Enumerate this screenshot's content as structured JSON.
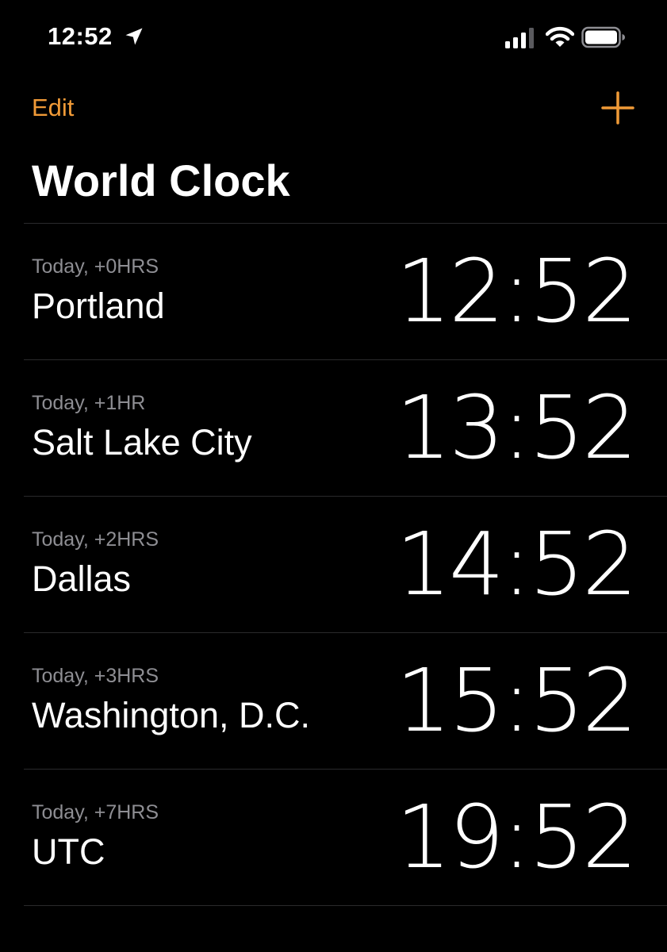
{
  "status_bar": {
    "time": "12:52",
    "icons": [
      "location-arrow-icon",
      "cellular-signal-icon",
      "wifi-icon",
      "battery-icon"
    ]
  },
  "nav": {
    "edit_label": "Edit",
    "add_icon": "plus-icon"
  },
  "title": "World Clock",
  "colors": {
    "accent": "#f09a37",
    "background": "#000000",
    "text_primary": "#ffffff",
    "text_secondary": "#8e8e93",
    "separator": "#2a2a2c"
  },
  "clocks": [
    {
      "offset": "Today, +0HRS",
      "city": "Portland",
      "time": "12:52"
    },
    {
      "offset": "Today, +1HR",
      "city": "Salt Lake City",
      "time": "13:52"
    },
    {
      "offset": "Today, +2HRS",
      "city": "Dallas",
      "time": "14:52"
    },
    {
      "offset": "Today, +3HRS",
      "city": "Washington, D.C.",
      "time": "15:52"
    },
    {
      "offset": "Today, +7HRS",
      "city": "UTC",
      "time": "19:52"
    }
  ]
}
